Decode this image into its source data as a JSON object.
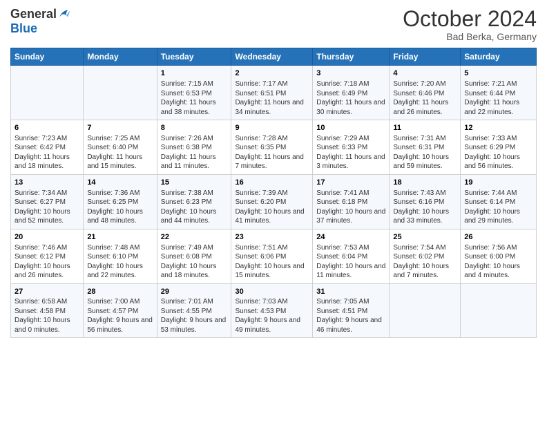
{
  "logo": {
    "general": "General",
    "blue": "Blue"
  },
  "header": {
    "month_year": "October 2024",
    "location": "Bad Berka, Germany"
  },
  "days_of_week": [
    "Sunday",
    "Monday",
    "Tuesday",
    "Wednesday",
    "Thursday",
    "Friday",
    "Saturday"
  ],
  "weeks": [
    [
      {
        "day": "",
        "sunrise": "",
        "sunset": "",
        "daylight": ""
      },
      {
        "day": "",
        "sunrise": "",
        "sunset": "",
        "daylight": ""
      },
      {
        "day": "1",
        "sunrise": "Sunrise: 7:15 AM",
        "sunset": "Sunset: 6:53 PM",
        "daylight": "Daylight: 11 hours and 38 minutes."
      },
      {
        "day": "2",
        "sunrise": "Sunrise: 7:17 AM",
        "sunset": "Sunset: 6:51 PM",
        "daylight": "Daylight: 11 hours and 34 minutes."
      },
      {
        "day": "3",
        "sunrise": "Sunrise: 7:18 AM",
        "sunset": "Sunset: 6:49 PM",
        "daylight": "Daylight: 11 hours and 30 minutes."
      },
      {
        "day": "4",
        "sunrise": "Sunrise: 7:20 AM",
        "sunset": "Sunset: 6:46 PM",
        "daylight": "Daylight: 11 hours and 26 minutes."
      },
      {
        "day": "5",
        "sunrise": "Sunrise: 7:21 AM",
        "sunset": "Sunset: 6:44 PM",
        "daylight": "Daylight: 11 hours and 22 minutes."
      }
    ],
    [
      {
        "day": "6",
        "sunrise": "Sunrise: 7:23 AM",
        "sunset": "Sunset: 6:42 PM",
        "daylight": "Daylight: 11 hours and 18 minutes."
      },
      {
        "day": "7",
        "sunrise": "Sunrise: 7:25 AM",
        "sunset": "Sunset: 6:40 PM",
        "daylight": "Daylight: 11 hours and 15 minutes."
      },
      {
        "day": "8",
        "sunrise": "Sunrise: 7:26 AM",
        "sunset": "Sunset: 6:38 PM",
        "daylight": "Daylight: 11 hours and 11 minutes."
      },
      {
        "day": "9",
        "sunrise": "Sunrise: 7:28 AM",
        "sunset": "Sunset: 6:35 PM",
        "daylight": "Daylight: 11 hours and 7 minutes."
      },
      {
        "day": "10",
        "sunrise": "Sunrise: 7:29 AM",
        "sunset": "Sunset: 6:33 PM",
        "daylight": "Daylight: 11 hours and 3 minutes."
      },
      {
        "day": "11",
        "sunrise": "Sunrise: 7:31 AM",
        "sunset": "Sunset: 6:31 PM",
        "daylight": "Daylight: 10 hours and 59 minutes."
      },
      {
        "day": "12",
        "sunrise": "Sunrise: 7:33 AM",
        "sunset": "Sunset: 6:29 PM",
        "daylight": "Daylight: 10 hours and 56 minutes."
      }
    ],
    [
      {
        "day": "13",
        "sunrise": "Sunrise: 7:34 AM",
        "sunset": "Sunset: 6:27 PM",
        "daylight": "Daylight: 10 hours and 52 minutes."
      },
      {
        "day": "14",
        "sunrise": "Sunrise: 7:36 AM",
        "sunset": "Sunset: 6:25 PM",
        "daylight": "Daylight: 10 hours and 48 minutes."
      },
      {
        "day": "15",
        "sunrise": "Sunrise: 7:38 AM",
        "sunset": "Sunset: 6:23 PM",
        "daylight": "Daylight: 10 hours and 44 minutes."
      },
      {
        "day": "16",
        "sunrise": "Sunrise: 7:39 AM",
        "sunset": "Sunset: 6:20 PM",
        "daylight": "Daylight: 10 hours and 41 minutes."
      },
      {
        "day": "17",
        "sunrise": "Sunrise: 7:41 AM",
        "sunset": "Sunset: 6:18 PM",
        "daylight": "Daylight: 10 hours and 37 minutes."
      },
      {
        "day": "18",
        "sunrise": "Sunrise: 7:43 AM",
        "sunset": "Sunset: 6:16 PM",
        "daylight": "Daylight: 10 hours and 33 minutes."
      },
      {
        "day": "19",
        "sunrise": "Sunrise: 7:44 AM",
        "sunset": "Sunset: 6:14 PM",
        "daylight": "Daylight: 10 hours and 29 minutes."
      }
    ],
    [
      {
        "day": "20",
        "sunrise": "Sunrise: 7:46 AM",
        "sunset": "Sunset: 6:12 PM",
        "daylight": "Daylight: 10 hours and 26 minutes."
      },
      {
        "day": "21",
        "sunrise": "Sunrise: 7:48 AM",
        "sunset": "Sunset: 6:10 PM",
        "daylight": "Daylight: 10 hours and 22 minutes."
      },
      {
        "day": "22",
        "sunrise": "Sunrise: 7:49 AM",
        "sunset": "Sunset: 6:08 PM",
        "daylight": "Daylight: 10 hours and 18 minutes."
      },
      {
        "day": "23",
        "sunrise": "Sunrise: 7:51 AM",
        "sunset": "Sunset: 6:06 PM",
        "daylight": "Daylight: 10 hours and 15 minutes."
      },
      {
        "day": "24",
        "sunrise": "Sunrise: 7:53 AM",
        "sunset": "Sunset: 6:04 PM",
        "daylight": "Daylight: 10 hours and 11 minutes."
      },
      {
        "day": "25",
        "sunrise": "Sunrise: 7:54 AM",
        "sunset": "Sunset: 6:02 PM",
        "daylight": "Daylight: 10 hours and 7 minutes."
      },
      {
        "day": "26",
        "sunrise": "Sunrise: 7:56 AM",
        "sunset": "Sunset: 6:00 PM",
        "daylight": "Daylight: 10 hours and 4 minutes."
      }
    ],
    [
      {
        "day": "27",
        "sunrise": "Sunrise: 6:58 AM",
        "sunset": "Sunset: 4:58 PM",
        "daylight": "Daylight: 10 hours and 0 minutes."
      },
      {
        "day": "28",
        "sunrise": "Sunrise: 7:00 AM",
        "sunset": "Sunset: 4:57 PM",
        "daylight": "Daylight: 9 hours and 56 minutes."
      },
      {
        "day": "29",
        "sunrise": "Sunrise: 7:01 AM",
        "sunset": "Sunset: 4:55 PM",
        "daylight": "Daylight: 9 hours and 53 minutes."
      },
      {
        "day": "30",
        "sunrise": "Sunrise: 7:03 AM",
        "sunset": "Sunset: 4:53 PM",
        "daylight": "Daylight: 9 hours and 49 minutes."
      },
      {
        "day": "31",
        "sunrise": "Sunrise: 7:05 AM",
        "sunset": "Sunset: 4:51 PM",
        "daylight": "Daylight: 9 hours and 46 minutes."
      },
      {
        "day": "",
        "sunrise": "",
        "sunset": "",
        "daylight": ""
      },
      {
        "day": "",
        "sunrise": "",
        "sunset": "",
        "daylight": ""
      }
    ]
  ]
}
